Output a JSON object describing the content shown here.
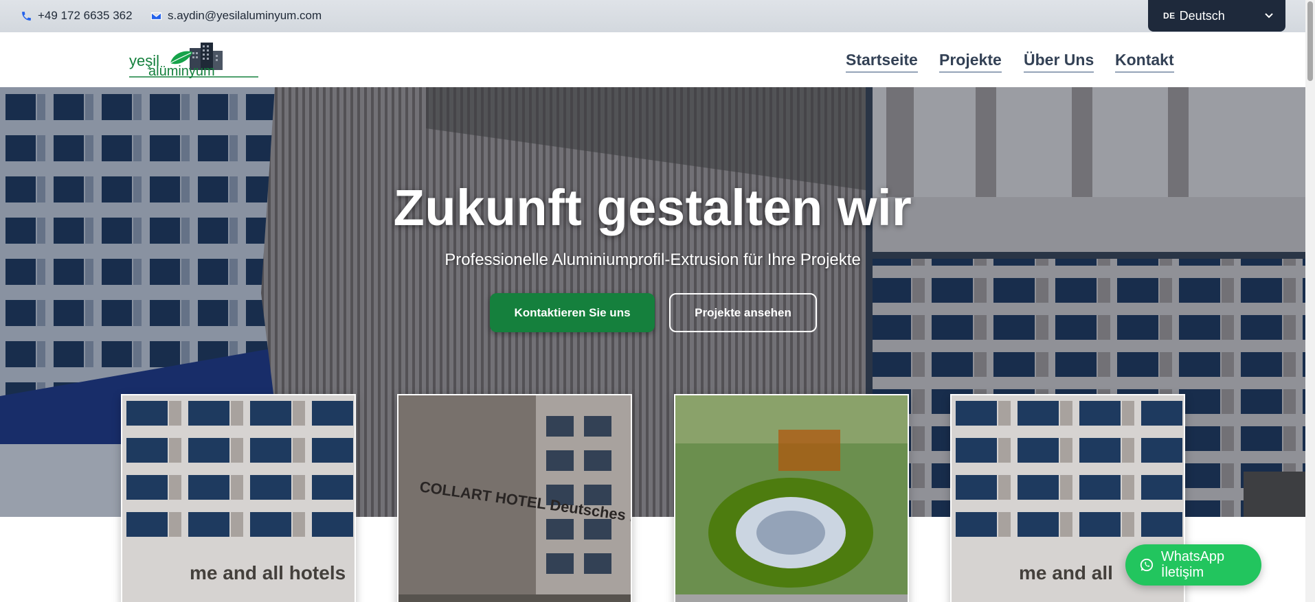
{
  "topbar": {
    "phone": "+49 172 6635 362",
    "email": "s.aydin@yesilaluminyum.com",
    "language": {
      "code": "DE",
      "label": "Deutsch"
    }
  },
  "header": {
    "logo_text_top": "yeşil",
    "logo_text_bottom": "alüminyum",
    "nav": [
      {
        "label": "Startseite"
      },
      {
        "label": "Projekte"
      },
      {
        "label": "Über Uns"
      },
      {
        "label": "Kontakt"
      }
    ]
  },
  "hero": {
    "title": "Zukunft gestalten wir",
    "subtitle": "Professionelle Aluminiumprofil-Extrusion für Ihre Projekte",
    "primary_button": "Kontaktieren Sie uns",
    "secondary_button": "Projekte ansehen"
  },
  "cards": [
    {
      "caption": "me and all hotels"
    },
    {
      "caption": "COLLART HOTEL Deutsches Haus"
    },
    {
      "caption": ""
    },
    {
      "caption": "me and all"
    }
  ],
  "whatsapp": {
    "label": "WhatsApp İletişim"
  },
  "colors": {
    "brand_green": "#15803d",
    "whatsapp_green": "#22c55e",
    "nav_text": "#334155",
    "lang_bg": "#1e293b"
  },
  "icons": {
    "phone": "phone-icon",
    "email": "envelope-icon",
    "whatsapp": "whatsapp-icon",
    "dropdown": "chevron-down-icon"
  }
}
